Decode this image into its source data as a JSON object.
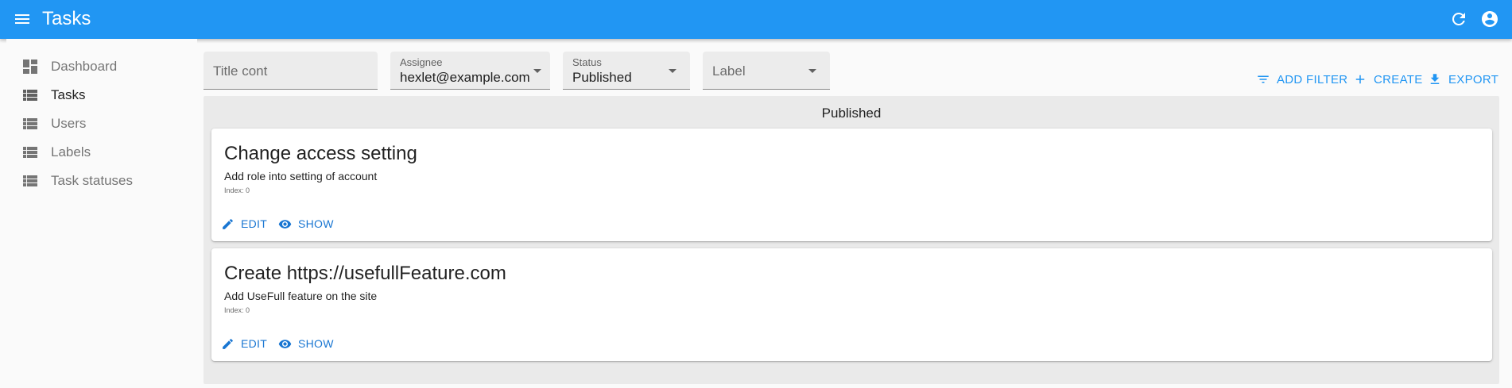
{
  "appbar": {
    "title": "Tasks",
    "color": "#2196f3",
    "menu_icon": "menu-icon",
    "refresh_icon": "refresh-icon",
    "account_icon": "account-circle-icon"
  },
  "sidebar": {
    "items": [
      {
        "label": "Dashboard",
        "icon": "dashboard-icon"
      },
      {
        "label": "Tasks",
        "icon": "list-icon",
        "active": true
      },
      {
        "label": "Users",
        "icon": "list-icon"
      },
      {
        "label": "Labels",
        "icon": "list-icon"
      },
      {
        "label": "Task statuses",
        "icon": "list-icon"
      }
    ]
  },
  "filters": {
    "title": {
      "placeholder": "Title cont"
    },
    "assignee": {
      "label": "Assignee",
      "value": "hexlet@example.com"
    },
    "status": {
      "label": "Status",
      "value": "Published"
    },
    "label": {
      "placeholder": "Label"
    }
  },
  "actions": {
    "add_filter": "ADD FILTER",
    "create": "CREATE",
    "export": "EXPORT"
  },
  "board": {
    "column_title": "Published",
    "cards": [
      {
        "title": "Change access setting",
        "description": "Add role into setting of account",
        "index": "Index: 0",
        "edit": "EDIT",
        "show": "SHOW"
      },
      {
        "title": "Create https://usefullFeature.com",
        "description": "Add UseFull feature on the site",
        "index": "Index: 0",
        "edit": "EDIT",
        "show": "SHOW"
      }
    ]
  }
}
